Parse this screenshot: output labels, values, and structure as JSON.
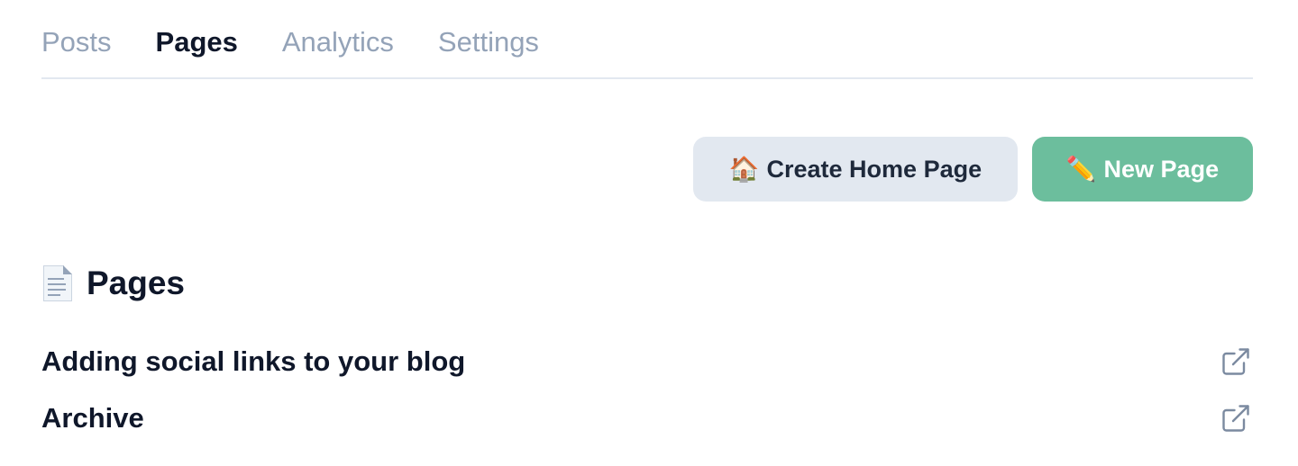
{
  "tabs": [
    {
      "label": "Posts",
      "active": false
    },
    {
      "label": "Pages",
      "active": true
    },
    {
      "label": "Analytics",
      "active": false
    },
    {
      "label": "Settings",
      "active": false
    }
  ],
  "actions": {
    "create_home": {
      "icon": "house-emoji-icon",
      "emoji": "🏠",
      "label": "Create Home Page"
    },
    "new_page": {
      "icon": "pencil-emoji-icon",
      "emoji": "✏️",
      "label": "New Page"
    }
  },
  "section": {
    "icon": "page-document-icon",
    "title": "Pages"
  },
  "pages": [
    {
      "title": "Adding social links to your blog",
      "action_icon": "external-link-icon"
    },
    {
      "title": "Archive",
      "action_icon": "external-link-icon"
    }
  ],
  "colors": {
    "accent_green": "#6cbe9d",
    "secondary_button": "#e2e8f0",
    "inactive_tab": "#94a3b8",
    "text_primary": "#0f172a"
  }
}
